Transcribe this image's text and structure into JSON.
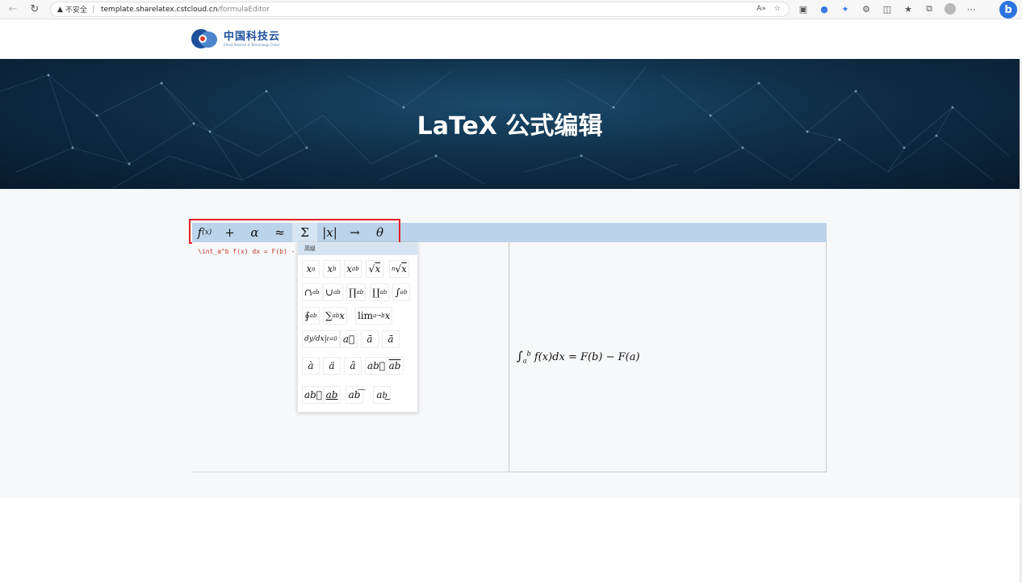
{
  "browser": {
    "security_label": "不安全",
    "url_host": "template.sharelatex.cstcloud.cn",
    "url_path": "/formulaEditor"
  },
  "site": {
    "logo_cn": "中国科技云",
    "logo_en": "China Science & Technology Cloud"
  },
  "banner": {
    "title": "LaTeX 公式编辑"
  },
  "editor": {
    "latex_source": "\\int_a^b f(x) dx = F(b) - F(",
    "symbol_groups": [
      {
        "name": "functions",
        "label": "f(x)"
      },
      {
        "name": "operators",
        "label": "+"
      },
      {
        "name": "greek",
        "label": "α"
      },
      {
        "name": "relations",
        "label": "≈"
      },
      {
        "name": "sums",
        "label": "Σ"
      },
      {
        "name": "delimiters",
        "label": "|x|"
      },
      {
        "name": "arrows",
        "label": "→"
      },
      {
        "name": "misc",
        "label": "θ"
      }
    ],
    "dropdown": {
      "header": "高级",
      "items": [
        "x_a",
        "x^b",
        "x_a^b",
        "√x",
        "∛x",
        "∩_a^b",
        "∪_a^b",
        "∏_a^b",
        "∐_a^b",
        "∫_a^b",
        "∮_a^b",
        "∑_a^b x",
        "lim_{a→b} x",
        "dy/dx|_{t=0}",
        "ā",
        "ä",
        "â",
        "à",
        "ä",
        "â",
        "←ab",
        "ab overline",
        "→ab",
        "ab underline",
        "ab overbrace",
        "ab underbrace"
      ]
    },
    "rendered": "∫ₐᵇ f(x)dx = F(b) − F(a)"
  }
}
